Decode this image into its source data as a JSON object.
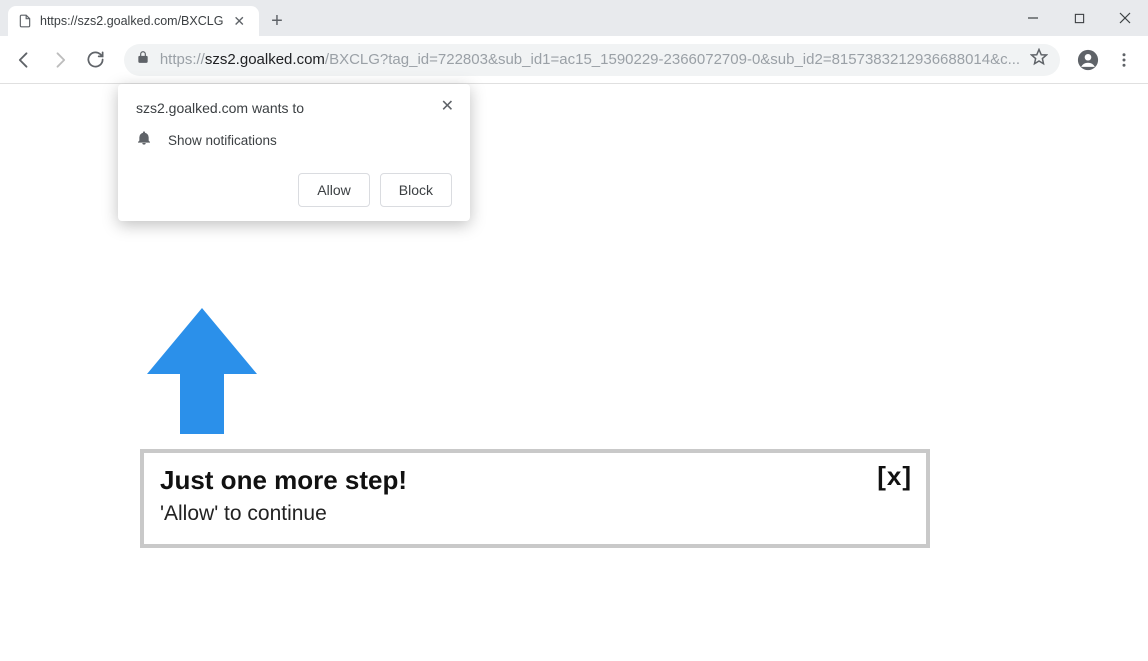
{
  "tab": {
    "title": "https://szs2.goalked.com/BXCLG"
  },
  "url": {
    "host": "szs2.goalked.com",
    "prefix": "https://",
    "path": "/BXCLG?tag_id=722803&sub_id1=ac15_1590229-2366072709-0&sub_id2=8157383212936688014&c..."
  },
  "permission": {
    "origin_wants": "szs2.goalked.com wants to",
    "label": "Show notifications",
    "allow": "Allow",
    "block": "Block"
  },
  "banner": {
    "title": "Just one more step!",
    "subtitle": "'Allow' to continue",
    "close": "[x]"
  }
}
